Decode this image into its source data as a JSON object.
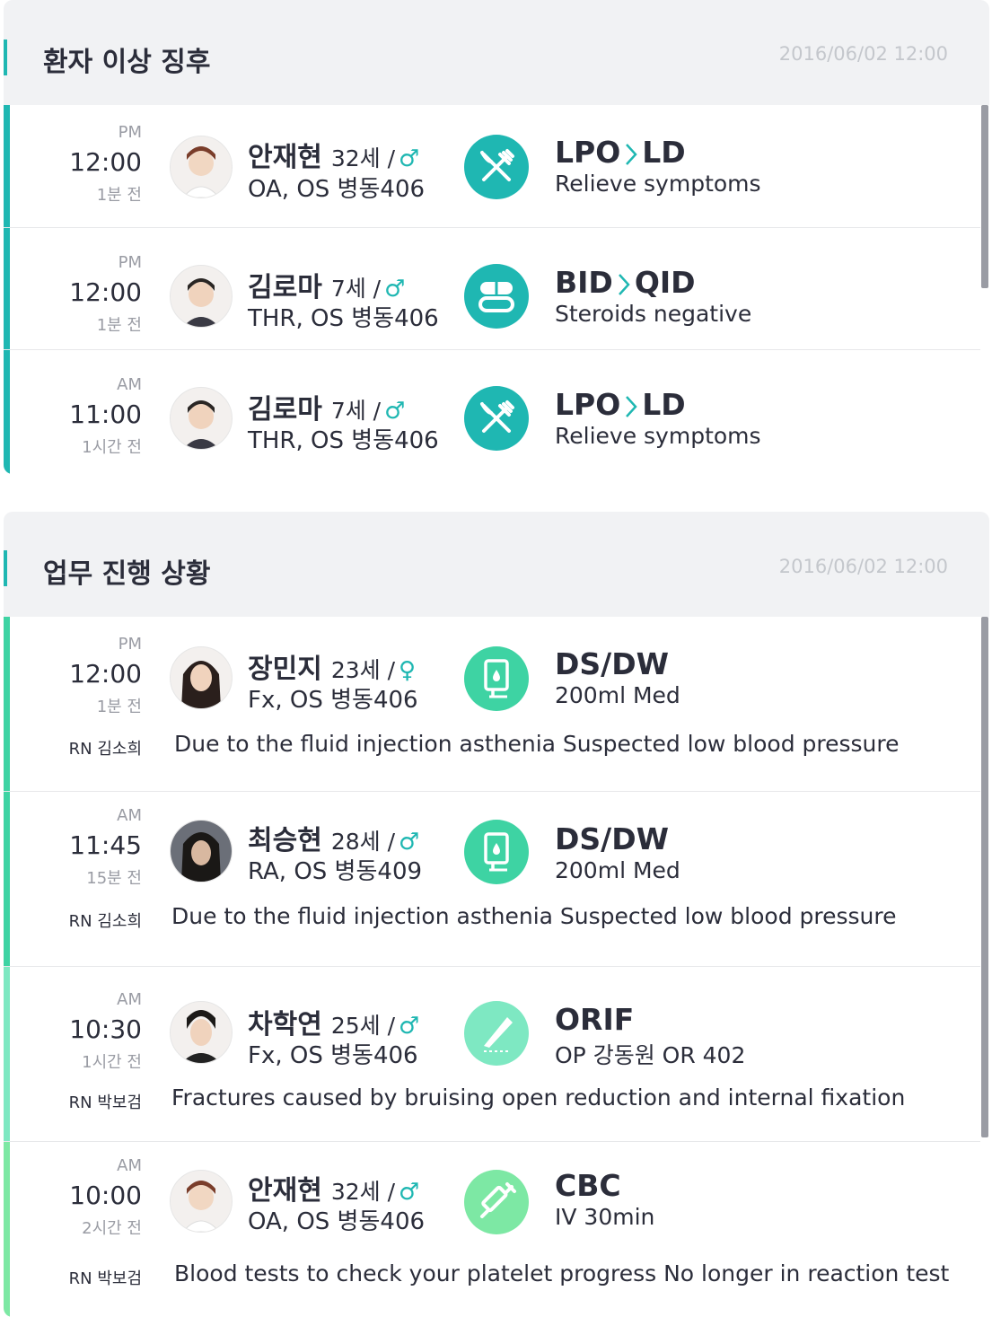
{
  "colors": {
    "teal": "#1fb7b2",
    "mint": "#3ed3a3",
    "light_mint": "#7ee8c2",
    "green": "#7de8a4"
  },
  "panel1": {
    "title": "환자 이상 징후",
    "date": "2016/06/02 12:00",
    "rows": [
      {
        "ampm": "PM",
        "time": "12:00",
        "ago": "1분 전",
        "name": "안재현",
        "age": "32세 /",
        "gender": "♂",
        "loc": "OA, OS 병동406",
        "icon": "fork-knife-icon",
        "order_from": "LPO",
        "order_to": "LD",
        "desc": "Relieve symptoms"
      },
      {
        "ampm": "PM",
        "time": "12:00",
        "ago": "1분 전",
        "name": "김로마",
        "age": "7세 /",
        "gender": "♂",
        "loc": "THR, OS 병동406",
        "icon": "pill-capsule-icon",
        "order_from": "BID",
        "order_to": "QID",
        "desc": "Steroids negative"
      },
      {
        "ampm": "AM",
        "time": "11:00",
        "ago": "1시간 전",
        "name": "김로마",
        "age": "7세 /",
        "gender": "♂",
        "loc": "THR, OS 병동406",
        "icon": "fork-knife-icon",
        "order_from": "LPO",
        "order_to": "LD",
        "desc": "Relieve symptoms"
      }
    ]
  },
  "panel2": {
    "title": "업무 진행 상황",
    "date": "2016/06/02 12:00",
    "rows": [
      {
        "ampm": "PM",
        "time": "12:00",
        "ago": "1분 전",
        "name": "장민지",
        "age": "23세 /",
        "gender": "♀",
        "loc": "Fx, OS 병동406",
        "icon": "iv-bag-icon",
        "order": "DS/DW",
        "desc": "200ml Med",
        "nurse": "RN 김소희",
        "note": "Due to the fluid injection asthenia Suspected low blood pressure"
      },
      {
        "ampm": "AM",
        "time": "11:45",
        "ago": "15분 전",
        "name": "최승현",
        "age": "28세 /",
        "gender": "♂",
        "loc": "RA, OS 병동409",
        "icon": "iv-bag-icon",
        "order": "DS/DW",
        "desc": "200ml Med",
        "nurse": "RN 김소희",
        "note": "Due to the fluid injection asthenia Suspected low blood pressure"
      },
      {
        "ampm": "AM",
        "time": "10:30",
        "ago": "1시간 전",
        "name": "차학연",
        "age": "25세 /",
        "gender": "♂",
        "loc": "Fx, OS 병동406",
        "icon": "scalpel-icon",
        "order": "ORIF",
        "desc": "OP 강동원 OR 402",
        "nurse": "RN 박보검",
        "note": "Fractures caused by bruising open reduction and internal fixation"
      },
      {
        "ampm": "AM",
        "time": "10:00",
        "ago": "2시간 전",
        "name": "안재현",
        "age": "32세 /",
        "gender": "♂",
        "loc": "OA, OS 병동406",
        "icon": "syringe-icon",
        "order": "CBC",
        "desc": "IV 30min",
        "nurse": "RN 박보검",
        "note": "Blood tests to check your platelet progress No longer in reaction test"
      }
    ]
  }
}
